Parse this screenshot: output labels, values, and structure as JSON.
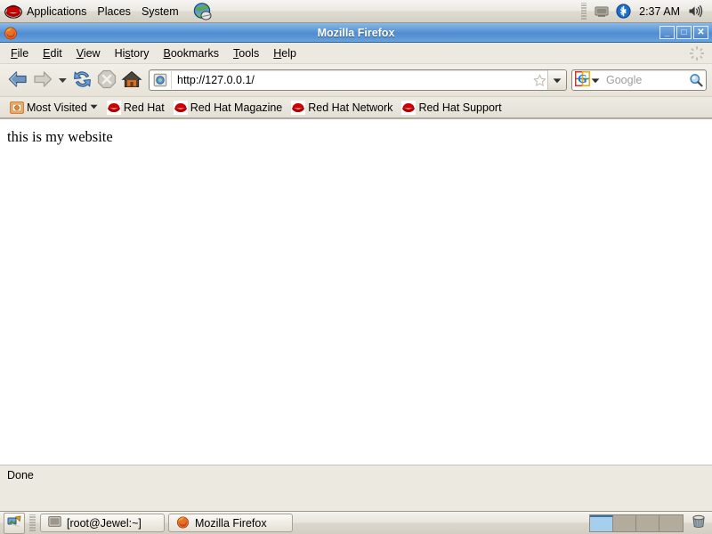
{
  "desktop": {
    "panel": {
      "menus": [
        {
          "label": "Applications",
          "icon": "redhat-logo-icon"
        },
        {
          "label": "Places",
          "icon": null
        },
        {
          "label": "System",
          "icon": null
        }
      ],
      "browser_launcher_icon": "globe-browser-icon",
      "tray": {
        "icons": [
          "display-monitor-icon",
          "bluetooth-icon",
          "volume-speaker-icon"
        ],
        "clock": "2:37 AM"
      }
    },
    "taskbar": {
      "show_desktop_icon": "show-desktop-icon",
      "windows": [
        {
          "label": "[root@Jewel:~]",
          "icon": "terminal-icon"
        },
        {
          "label": "Mozilla Firefox",
          "icon": "firefox-icon"
        }
      ],
      "workspaces": [
        {
          "name": "workspace-1",
          "active": true
        },
        {
          "name": "workspace-2",
          "active": false
        },
        {
          "name": "workspace-3",
          "active": false
        },
        {
          "name": "workspace-4",
          "active": false
        }
      ],
      "trash_icon": "trash-icon"
    }
  },
  "browser": {
    "window_title": "Mozilla Firefox",
    "window_buttons": {
      "minimize": "_",
      "maximize": "□",
      "close": "✕"
    },
    "menubar": [
      {
        "pre": "",
        "key": "F",
        "post": "ile"
      },
      {
        "pre": "",
        "key": "E",
        "post": "dit"
      },
      {
        "pre": "",
        "key": "V",
        "post": "iew"
      },
      {
        "pre": "Hi",
        "key": "s",
        "post": "tory"
      },
      {
        "pre": "",
        "key": "B",
        "post": "ookmarks"
      },
      {
        "pre": "",
        "key": "T",
        "post": "ools"
      },
      {
        "pre": "",
        "key": "H",
        "post": "elp"
      }
    ],
    "toolbar": {
      "back": "Back",
      "forward": "Forward",
      "history_dropdown": "Recent Pages",
      "reload": "Reload",
      "stop": "Stop",
      "home": "Home"
    },
    "address_bar": {
      "url": "http://127.0.0.1/",
      "favicon": "generic-page-icon",
      "bookmark_star": "star-icon",
      "dropdown": "▼"
    },
    "search_bar": {
      "engine": "Google",
      "engine_letter": "G",
      "placeholder": "Google",
      "go_icon": "magnifier-icon",
      "dropdown": "▼"
    },
    "bookmarks_toolbar": [
      {
        "label": "Most Visited",
        "icon": "most-visited-folder-icon",
        "has_caret": true
      },
      {
        "label": "Red Hat",
        "icon": "redhat-bookmark-icon",
        "has_caret": false
      },
      {
        "label": "Red Hat Magazine",
        "icon": "redhat-bookmark-icon",
        "has_caret": false
      },
      {
        "label": "Red Hat Network",
        "icon": "redhat-bookmark-icon",
        "has_caret": false
      },
      {
        "label": "Red Hat Support",
        "icon": "redhat-bookmark-icon",
        "has_caret": false
      }
    ],
    "page": {
      "body_text": "this is my website"
    },
    "status_bar": {
      "text": "Done"
    }
  },
  "colors": {
    "titlebar_blue": "#5f99d6",
    "panel_gray": "#ece9e0",
    "redhat_red": "#cc0000",
    "active_workspace": "#a6cfee",
    "placeholder_gray": "#9d9d9d"
  }
}
